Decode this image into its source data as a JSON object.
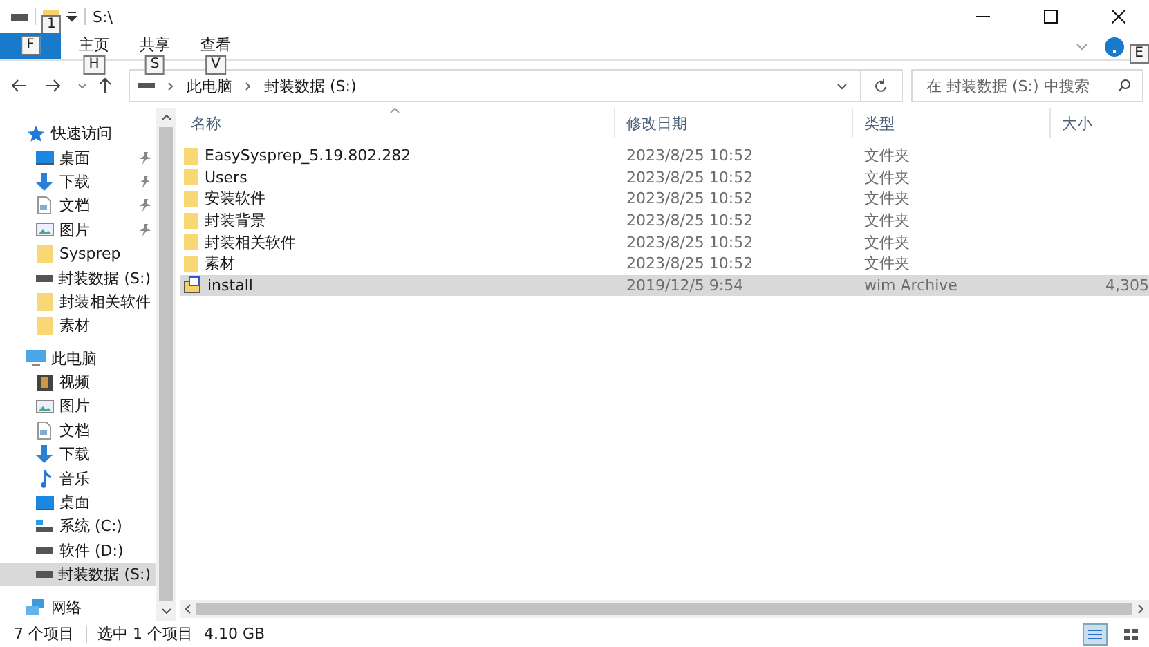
{
  "window": {
    "title": "S:\\",
    "quick_access_tip": "1"
  },
  "ribbon": {
    "tabs": [
      {
        "selected": true,
        "keytip": "F"
      },
      {
        "label": "主页",
        "selected": false,
        "keytip": "H"
      },
      {
        "label": "共享",
        "selected": false,
        "keytip": "S"
      },
      {
        "label": "查看",
        "selected": false,
        "keytip": "V"
      }
    ],
    "help_keytip": "E"
  },
  "address": {
    "crumbs": [
      "此电脑",
      "封装数据 (S:)"
    ]
  },
  "search": {
    "placeholder": "在 封装数据 (S:) 中搜索"
  },
  "sidebar": {
    "items": [
      {
        "kind": "star",
        "label": "快速访问",
        "pinned": false,
        "selected": false,
        "children": [
          {
            "kind": "desktop",
            "label": "桌面",
            "pinned": true,
            "selected": false
          },
          {
            "kind": "download",
            "label": "下载",
            "pinned": true,
            "selected": false
          },
          {
            "kind": "document",
            "label": "文档",
            "pinned": true,
            "selected": false
          },
          {
            "kind": "image",
            "label": "图片",
            "pinned": true,
            "selected": false
          },
          {
            "kind": "folder",
            "label": "Sysprep",
            "pinned": false,
            "selected": false
          },
          {
            "kind": "drive",
            "label": "封装数据 (S:)",
            "pinned": false,
            "selected": false
          },
          {
            "kind": "folder",
            "label": "封装相关软件",
            "pinned": false,
            "selected": false
          },
          {
            "kind": "folder",
            "label": "素材",
            "pinned": false,
            "selected": false
          }
        ]
      },
      {
        "kind": "pc",
        "label": "此电脑",
        "pinned": false,
        "selected": false,
        "children": [
          {
            "kind": "video",
            "label": "视频",
            "pinned": false,
            "selected": false
          },
          {
            "kind": "image",
            "label": "图片",
            "pinned": false,
            "selected": false
          },
          {
            "kind": "document",
            "label": "文档",
            "pinned": false,
            "selected": false
          },
          {
            "kind": "download",
            "label": "下载",
            "pinned": false,
            "selected": false
          },
          {
            "kind": "music",
            "label": "音乐",
            "pinned": false,
            "selected": false
          },
          {
            "kind": "desktop",
            "label": "桌面",
            "pinned": false,
            "selected": false
          },
          {
            "kind": "system-drive",
            "label": "系统 (C:)",
            "pinned": false,
            "selected": false
          },
          {
            "kind": "drive",
            "label": "软件 (D:)",
            "pinned": false,
            "selected": false
          },
          {
            "kind": "drive",
            "label": "封装数据 (S:)",
            "pinned": false,
            "selected": true
          }
        ]
      },
      {
        "kind": "network",
        "label": "网络",
        "pinned": false,
        "selected": false
      }
    ]
  },
  "table": {
    "columns": [
      "名称",
      "修改日期",
      "类型",
      "大小"
    ],
    "rows": [
      {
        "kind": "folder",
        "name": "EasySysprep_5.19.802.282",
        "date": "2023/8/25 10:52",
        "type": "文件夹",
        "selected": false
      },
      {
        "kind": "folder",
        "name": "Users",
        "date": "2023/8/25 10:52",
        "type": "文件夹",
        "selected": false
      },
      {
        "kind": "folder",
        "name": "安装软件",
        "date": "2023/8/25 10:52",
        "type": "文件夹",
        "selected": false
      },
      {
        "kind": "folder",
        "name": "封装背景",
        "date": "2023/8/25 10:52",
        "type": "文件夹",
        "selected": false
      },
      {
        "kind": "folder",
        "name": "封装相关软件",
        "date": "2023/8/25 10:52",
        "type": "文件夹",
        "selected": false
      },
      {
        "kind": "folder",
        "name": "素材",
        "date": "2023/8/25 10:52",
        "type": "文件夹",
        "selected": false
      },
      {
        "kind": "archive",
        "name": "install",
        "date": "2019/12/5 9:54",
        "type": "wim Archive",
        "size": "4,305",
        "selected": true
      }
    ]
  },
  "status_bar": {
    "count": "7 个项目",
    "selection": "选中 1 个项目",
    "size": "4.10 GB"
  }
}
